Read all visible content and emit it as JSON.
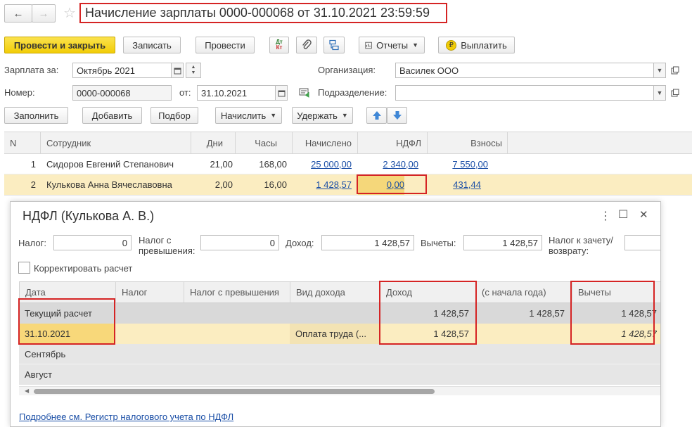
{
  "header": {
    "back_label": "←",
    "forward_label": "→",
    "star_label": "☆",
    "title": "Начисление зарплаты 0000-000068 от 31.10.2021 23:59:59"
  },
  "toolbar": {
    "post_close": "Провести и закрыть",
    "save": "Записать",
    "post": "Провести",
    "dtkt_top": "Дт",
    "dtkt_bottom": "Кт",
    "reports": "Отчеты",
    "pay": "Выплатить",
    "pay_icon": "₽"
  },
  "form": {
    "salary_for_label": "Зарплата за:",
    "salary_for_value": "Октябрь 2021",
    "org_label": "Организация:",
    "org_value": "Василек ООО",
    "number_label": "Номер:",
    "number_value": "0000-000068",
    "from_label": "от:",
    "date_value": "31.10.2021",
    "division_label": "Подразделение:",
    "division_value": ""
  },
  "tabletoolbar": {
    "fill": "Заполнить",
    "add": "Добавить",
    "select": "Подбор",
    "accrue": "Начислить",
    "withhold": "Удержать"
  },
  "main_table": {
    "columns": [
      "N",
      "Сотрудник",
      "Дни",
      "Часы",
      "Начислено",
      "НДФЛ",
      "Взносы"
    ],
    "rows": [
      {
        "n": "1",
        "employee": "Сидоров Евгений Степанович",
        "days": "21,00",
        "hours": "168,00",
        "accrued": "25 000,00",
        "ndfl": "2 340,00",
        "contrib": "7 550,00"
      },
      {
        "n": "2",
        "employee": "Кулькова Анна Вячеславовна",
        "days": "2,00",
        "hours": "16,00",
        "accrued": "1 428,57",
        "ndfl": "0,00",
        "contrib": "431,44"
      }
    ]
  },
  "dialog": {
    "title": "НДФЛ (Кулькова А. В.)",
    "more_icon": "⋮",
    "max_icon": "☐",
    "close_icon": "✕",
    "tax_label": "Налог:",
    "tax_value": "0",
    "excess_label_1": "Налог с",
    "excess_label_2": "превышения:",
    "excess_value": "0",
    "income_label": "Доход:",
    "income_value": "1 428,57",
    "deductions_label": "Вычеты:",
    "deductions_value": "1 428,57",
    "offset_label_1": "Налог к зачету/",
    "offset_label_2": "возврату:",
    "offset_value": "",
    "correct_label": "Корректировать расчет",
    "columns": [
      "Дата",
      "Налог",
      "Налог с превышения",
      "Вид дохода",
      "Доход",
      "(с начала года)",
      "Вычеты"
    ],
    "rows": [
      {
        "date": "Текущий расчет",
        "tax": "",
        "excess": "",
        "kind": "",
        "income": "1 428,57",
        "ytd": "1 428,57",
        "deductions": "1 428,57"
      },
      {
        "date": "31.10.2021",
        "tax": "",
        "excess": "",
        "kind": "Оплата труда (...",
        "income": "1 428,57",
        "ytd": "",
        "deductions": "1 428,57"
      },
      {
        "date": "Сентябрь",
        "tax": "",
        "excess": "",
        "kind": "",
        "income": "",
        "ytd": "",
        "deductions": ""
      },
      {
        "date": "Август",
        "tax": "",
        "excess": "",
        "kind": "",
        "income": "",
        "ytd": "",
        "deductions": ""
      }
    ],
    "footer_link": "Подробнее см. Регистр налогового учета по НДФЛ"
  }
}
